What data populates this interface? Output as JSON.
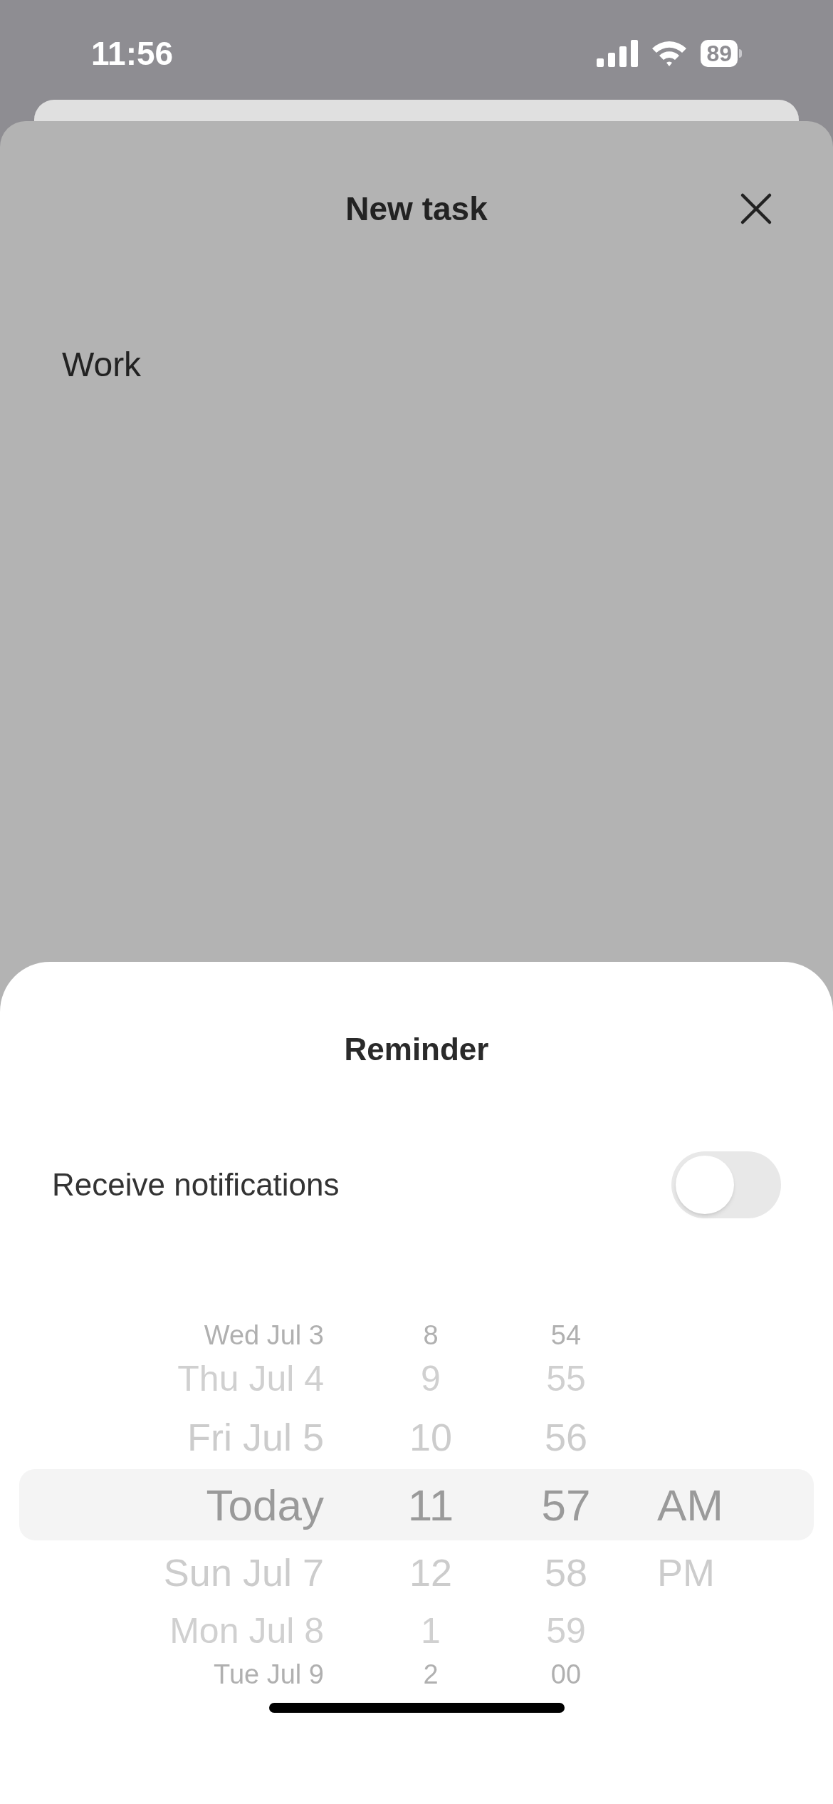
{
  "status_bar": {
    "time": "11:56",
    "battery": "89"
  },
  "task_sheet": {
    "title": "New task",
    "list": "Work"
  },
  "reminder": {
    "title": "Reminder",
    "notifications": {
      "label": "Receive notifications",
      "on": false
    }
  },
  "picker": {
    "rows": [
      {
        "date": "Wed Jul 3",
        "hour": "8",
        "minute": "54",
        "selected": false
      },
      {
        "date": "Thu Jul 4",
        "hour": "9",
        "minute": "55",
        "selected": false
      },
      {
        "date": "Fri Jul 5",
        "hour": "10",
        "minute": "56",
        "selected": false
      },
      {
        "date": "Today",
        "hour": "11",
        "minute": "57",
        "period": "AM",
        "selected": true
      },
      {
        "date": "Sun Jul 7",
        "hour": "12",
        "minute": "58",
        "period": "PM",
        "selected": false
      },
      {
        "date": "Mon Jul 8",
        "hour": "1",
        "minute": "59",
        "selected": false
      },
      {
        "date": "Tue Jul 9",
        "hour": "2",
        "minute": "00",
        "selected": false
      }
    ]
  }
}
